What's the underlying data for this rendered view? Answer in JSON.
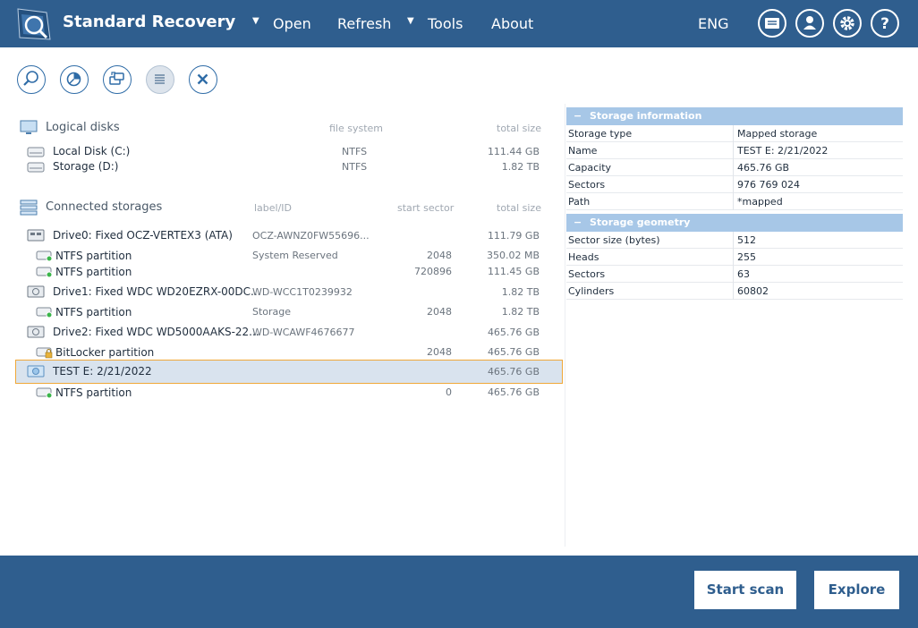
{
  "app": {
    "title": "Standard Recovery"
  },
  "nav": {
    "open": "Open",
    "refresh": "Refresh",
    "tools": "Tools",
    "about": "About",
    "lang": "ENG"
  },
  "logical": {
    "title": "Logical disks",
    "col_fs": "file system",
    "col_size": "total size",
    "rows": [
      {
        "name": "Local Disk (C:)",
        "fs": "NTFS",
        "size": "111.44 GB"
      },
      {
        "name": "Storage (D:)",
        "fs": "NTFS",
        "size": "1.82 TB"
      }
    ]
  },
  "connected": {
    "title": "Connected storages",
    "col_label": "label/ID",
    "col_start": "start sector",
    "col_size": "total size",
    "rows": [
      {
        "name": "Drive0: Fixed OCZ-VERTEX3 (ATA)",
        "label": "OCZ-AWNZ0FW55696...",
        "start": "",
        "size": "111.79 GB"
      },
      {
        "name": "NTFS partition",
        "label": "System Reserved",
        "start": "2048",
        "size": "350.02 MB"
      },
      {
        "name": "NTFS partition",
        "label": "",
        "start": "720896",
        "size": "111.45 GB"
      },
      {
        "name": "Drive1: Fixed WDC WD20EZRX-00DC...",
        "label": "WD-WCC1T0239932",
        "start": "",
        "size": "1.82 TB"
      },
      {
        "name": "NTFS partition",
        "label": "Storage",
        "start": "2048",
        "size": "1.82 TB"
      },
      {
        "name": "Drive2: Fixed WDC WD5000AAKS-22...",
        "label": "WD-WCAWF4676677",
        "start": "",
        "size": "465.76 GB"
      },
      {
        "name": "BitLocker partition",
        "label": "",
        "start": "2048",
        "size": "465.76 GB"
      },
      {
        "name": "TEST E: 2/21/2022",
        "label": "",
        "start": "",
        "size": "465.76 GB"
      },
      {
        "name": "NTFS partition",
        "label": "",
        "start": "0",
        "size": "465.76 GB"
      }
    ]
  },
  "storage_info": {
    "title": "Storage information",
    "rows": [
      {
        "key": "Storage type",
        "value": "Mapped storage"
      },
      {
        "key": "Name",
        "value": "TEST E: 2/21/2022"
      },
      {
        "key": "Capacity",
        "value": "465.76 GB"
      },
      {
        "key": "Sectors",
        "value": "976 769 024"
      },
      {
        "key": "Path",
        "value": "*mapped"
      }
    ]
  },
  "storage_geometry": {
    "title": "Storage geometry",
    "rows": [
      {
        "key": "Sector size (bytes)",
        "value": "512"
      },
      {
        "key": "Heads",
        "value": "255"
      },
      {
        "key": "Sectors",
        "value": "63"
      },
      {
        "key": "Cylinders",
        "value": "60802"
      }
    ]
  },
  "actions": {
    "start_scan": "Start scan",
    "explore": "Explore"
  },
  "colors": {
    "brand": "#2f5e8e",
    "panel_header": "#a7c7e7",
    "selection": "#d9e3ee",
    "selection_border": "#f0a838"
  }
}
